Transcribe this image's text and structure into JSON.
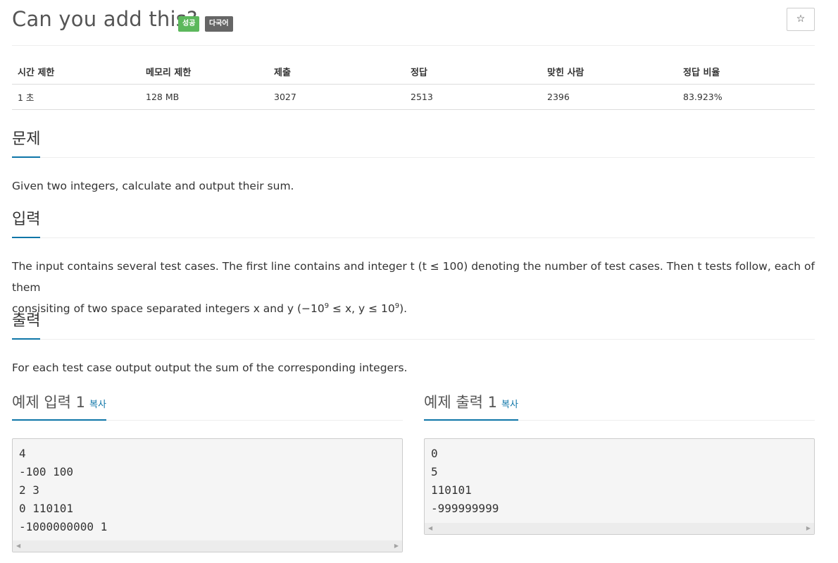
{
  "problem": {
    "title": "Can you add this?",
    "badges": {
      "success": "성공",
      "multilang": "다국어"
    },
    "star_glyph": "☆"
  },
  "info_table": {
    "headers": [
      "시간 제한",
      "메모리 제한",
      "제출",
      "정답",
      "맞힌 사람",
      "정답 비율"
    ],
    "values": [
      "1 초",
      "128 MB",
      "3027",
      "2513",
      "2396",
      "83.923%"
    ]
  },
  "sections": {
    "description": {
      "heading": "문제",
      "text": "Given two integers, calculate and output their sum."
    },
    "input": {
      "heading": "입력",
      "line1": "The input contains several test cases. The first line contains and integer t (t ≤ 100) denoting the number of test cases. Then t tests follow, each of them",
      "line2_pre": "consisiting of two space separated integers x and y (−10",
      "exp1": "9",
      "line2_mid": " ≤ x, y ≤ 10",
      "exp2": "9",
      "line2_post": ")."
    },
    "output": {
      "heading": "출력",
      "text": "For each test case output output the sum of the corresponding integers."
    }
  },
  "samples": {
    "copy_label": "복사",
    "input": {
      "heading": "예제 입력 1",
      "content": "4\n-100 100\n2 3\n0 110101\n-1000000000 1"
    },
    "output": {
      "heading": "예제 출력 1",
      "content": "0\n5\n110101\n-999999999"
    }
  },
  "colors": {
    "accent": "#0e76a8",
    "success_badge": "#5cb85c",
    "language_badge": "#666666",
    "sample_background": "#f5f5f5"
  },
  "icons": {
    "star": "star-icon",
    "scroll_left": "scroll-left-arrow-icon",
    "scroll_right": "scroll-right-arrow-icon"
  }
}
